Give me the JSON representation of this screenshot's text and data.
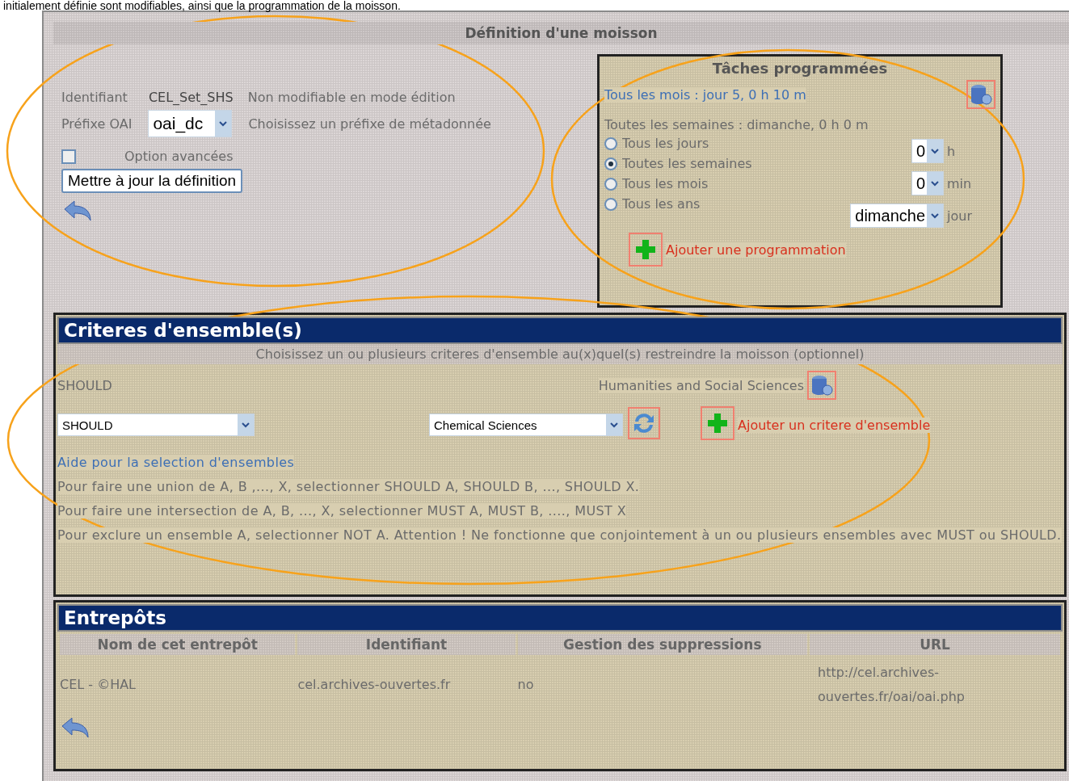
{
  "caption": "initialement définie sont modifiables, ainsi que la programmation de la moisson.",
  "definition": {
    "title": "Définition d'une moisson",
    "identifier": {
      "label": "Identifiant",
      "value": "CEL_Set_SHS",
      "note": "Non modifiable en mode édition"
    },
    "prefix": {
      "label": "Préfixe OAI",
      "value": "oai_dc",
      "note": "Choisissez un préfixe de métadonnée"
    },
    "advanced": {
      "label": "Option avancées",
      "checked": false
    },
    "update_button": "Mettre à jour la définition"
  },
  "tasks": {
    "title": "Tâches programmées",
    "scheduled": [
      "Tous les mois : jour 5, 0 h 10 m"
    ],
    "current": "Toutes les semaines : dimanche, 0 h 0 m",
    "frequencies": [
      {
        "label": "Tous les jours",
        "selected": false
      },
      {
        "label": "Toutes les semaines",
        "selected": true
      },
      {
        "label": "Tous les mois",
        "selected": false
      },
      {
        "label": "Tous les ans",
        "selected": false
      }
    ],
    "fields": [
      {
        "value": "0",
        "unit": "h"
      },
      {
        "value": "0",
        "unit": "min"
      },
      {
        "value": "dimanche",
        "unit": "jour"
      }
    ],
    "add_link": "Ajouter une programmation"
  },
  "criteria": {
    "title": "Criteres d'ensemble(s)",
    "subtitle": "Choisissez un ou plusieurs criteres d'ensemble au(x)quel(s) restreindre la moisson (optionnel)",
    "existing": [
      {
        "operator": "SHOULD",
        "set": "Humanities and Social Sciences"
      }
    ],
    "operator_select": "SHOULD",
    "set_select": "Chemical Sciences",
    "add_link": "Ajouter un critere d'ensemble",
    "help_link": "Aide pour la selection d'ensembles",
    "help": [
      "Pour faire une union de A, B ,..., X, selectionner SHOULD A, SHOULD B, ..., SHOULD X.",
      "Pour faire une intersection de A, B, ..., X, selectionner MUST A, MUST B, ...., MUST X",
      "Pour exclure un ensemble A, selectionner NOT A. Attention ! Ne fonctionne que conjointement à un ou plusieurs ensembles avec MUST ou SHOULD."
    ]
  },
  "repositories": {
    "title": "Entrepôts",
    "columns": [
      "Nom de cet entrepôt",
      "Identifiant",
      "Gestion des suppressions",
      "URL"
    ],
    "rows": [
      [
        "CEL - ©HAL",
        "cel.archives-ouvertes.fr",
        "no",
        "http://cel.archives-ouvertes.fr/oai/oai.php"
      ]
    ]
  }
}
